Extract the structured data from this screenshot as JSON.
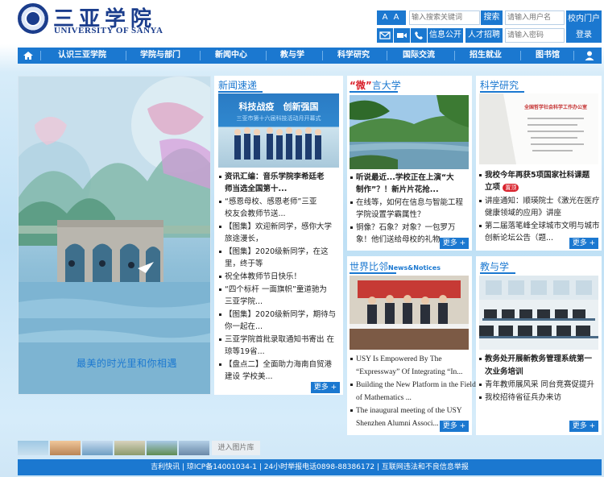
{
  "header": {
    "logo_cn": "三亚学院",
    "logo_en": "UNIVERSITY OF SANYA",
    "font_size_label": "A A A",
    "search_placeholder": "输入搜索关键词",
    "search_btn": "搜索",
    "username_placeholder": "请输入用户名",
    "password_placeholder": "请输入密码",
    "portal_btn": "校内门户",
    "login_btn": "登录",
    "public_info_btn": "信息公开",
    "talent_btn": "人才招聘",
    "icons": [
      "mail-icon",
      "video-icon",
      "phone-icon"
    ]
  },
  "nav": {
    "items": [
      "认识三亚学院",
      "学院与部门",
      "新闻中心",
      "教与学",
      "科学研究",
      "国际交流",
      "招生就业",
      "图书馆"
    ]
  },
  "hero": {
    "caption": "最美的时光里和你相遇"
  },
  "news": {
    "title": "新闻速递",
    "image_banner_1": "科技战疫　创新强国",
    "image_banner_2": "三亚市第十六届科技活动月开幕式",
    "items": [
      "资讯汇编：音乐学院李希廷老",
      "师当选全国第十...",
      "“感恩母校、感恩老师”三亚",
      "校友会教师节送...",
      "【图集】欢迎新同学，感你大学",
      "旅途漫长，",
      "【图集】2020级新同学，在这",
      "里，终于等",
      "祝全体教师节日快乐！",
      "“四个标杆 一面旗帜”童道驰为",
      "三亚学院...",
      "【图集】2020级新同学，期待与",
      "你一起在...",
      "三亚学院首批录取通知书寄出 在",
      "琼等19省...",
      "【盘点二】全面助力海南自贸港",
      "建设 学校美..."
    ],
    "more": "更多 +"
  },
  "wei": {
    "title_accent": "“微”",
    "title_rest": "言大学",
    "items": [
      "听说最近...学校正在上演“大",
      "制作”？！新片片花抢...",
      "在线等，如何在信息与智能工程",
      "学院设置学霸属性？",
      "铜像？石象？对象？一包罗万",
      "象！他们送给母校的礼物..."
    ],
    "more": "更多 +"
  },
  "research": {
    "title": "科学研究",
    "doc_heading": "全国哲学社会科学工作办公室",
    "items": [
      "我校今年再获5项国家社科课题",
      "立项",
      "讲座通知：顺瑛院士《激光在医疗",
      "健康领域的应用》讲座",
      "第二届落笔峰全球城市文明与城市",
      "创新论坛公告（题..."
    ],
    "new_badge": "置顶",
    "more": "更多 +"
  },
  "world": {
    "title": "世界比邻",
    "title_en": "News&Notices",
    "items": [
      "USY Is Empowered By The",
      "“Expressway” Of Integrating “In...",
      "Building the New Platform in the Field",
      "of Mathematics ...",
      "The inaugural meeting of the USY",
      "Shenzhen Alumni Associ..."
    ],
    "more": "更多 +"
  },
  "teaching": {
    "title": "教与学",
    "items": [
      "教务处开展新教务管理系统第一",
      "次业务培训",
      "青年教师展风采 同台竞赛促提升",
      "我校招待省征兵办来访"
    ],
    "more": "更多 +"
  },
  "gallery": {
    "more_pics": "进入图片库"
  },
  "footer": {
    "text": "吉利快讯 | 琼ICP备14001034-1 | 24小时举报电话0898-88386172 | 互联网违法和不良信息举报"
  },
  "colors": {
    "primary": "#1b78d0",
    "logo_navy": "#1b3d8c",
    "accent_red": "#d9232d"
  }
}
